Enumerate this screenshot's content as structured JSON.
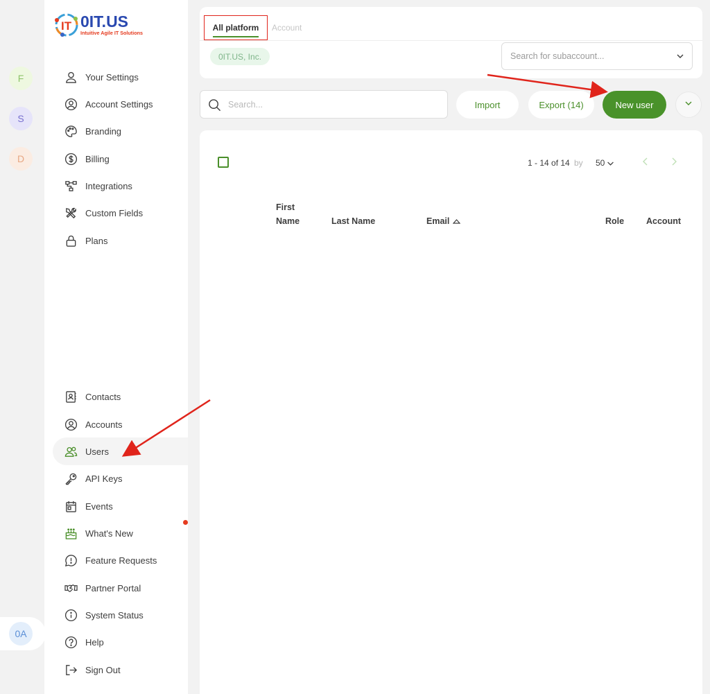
{
  "rail": {
    "avatars": [
      {
        "letter": "F",
        "bg": "#eef8e0",
        "fg": "#8fc46a"
      },
      {
        "letter": "S",
        "bg": "#e6e4fa",
        "fg": "#7870cf"
      },
      {
        "letter": "D",
        "bg": "#fbece2",
        "fg": "#e7a783"
      }
    ],
    "bottom_avatar": {
      "letter": "0A",
      "bg": "#e3eefb",
      "fg": "#5b8fd6"
    }
  },
  "logo": {
    "brand": "0IT.US",
    "tagline": "Intuitive Agile IT Solutions"
  },
  "sidebar": {
    "top_items": [
      {
        "label": "Your Settings",
        "icon": "user-icon"
      },
      {
        "label": "Account Settings",
        "icon": "account-circle-icon"
      },
      {
        "label": "Branding",
        "icon": "palette-icon"
      },
      {
        "label": "Billing",
        "icon": "dollar-icon"
      },
      {
        "label": "Integrations",
        "icon": "integrations-icon"
      },
      {
        "label": "Custom Fields",
        "icon": "tools-icon"
      },
      {
        "label": "Plans",
        "icon": "lock-icon"
      }
    ],
    "bottom_items": [
      {
        "label": "Contacts",
        "icon": "contacts-icon"
      },
      {
        "label": "Accounts",
        "icon": "account-circle-icon"
      },
      {
        "label": "Users",
        "icon": "users-icon",
        "active": true
      },
      {
        "label": "API Keys",
        "icon": "key-icon"
      },
      {
        "label": "Events",
        "icon": "calendar-icon"
      },
      {
        "label": "What's New",
        "icon": "cake-icon"
      },
      {
        "label": "Feature Requests",
        "icon": "feature-request-icon"
      },
      {
        "label": "Partner Portal",
        "icon": "handshake-icon"
      },
      {
        "label": "System Status",
        "icon": "info-icon"
      },
      {
        "label": "Help",
        "icon": "help-icon"
      },
      {
        "label": "Sign Out",
        "icon": "sign-out-icon"
      }
    ]
  },
  "tabs": {
    "all_platform": "All platform",
    "account": "Account"
  },
  "chip": "0IT.US, Inc.",
  "subaccount_search": {
    "placeholder": "Search for subaccount..."
  },
  "toolbar": {
    "search_placeholder": "Search...",
    "import_label": "Import",
    "export_label": "Export (14)",
    "new_user_label": "New user"
  },
  "pager": {
    "range": "1 - 14 of 14",
    "by": "by",
    "page_size": "50"
  },
  "table": {
    "columns": {
      "first_name_1": "First",
      "first_name_2": "Name",
      "last_name": "Last Name",
      "email": "Email",
      "role": "Role",
      "account": "Account"
    }
  },
  "colors": {
    "accent": "#49922a",
    "highlight_border": "#e0241b",
    "arrow": "#e0241b"
  }
}
